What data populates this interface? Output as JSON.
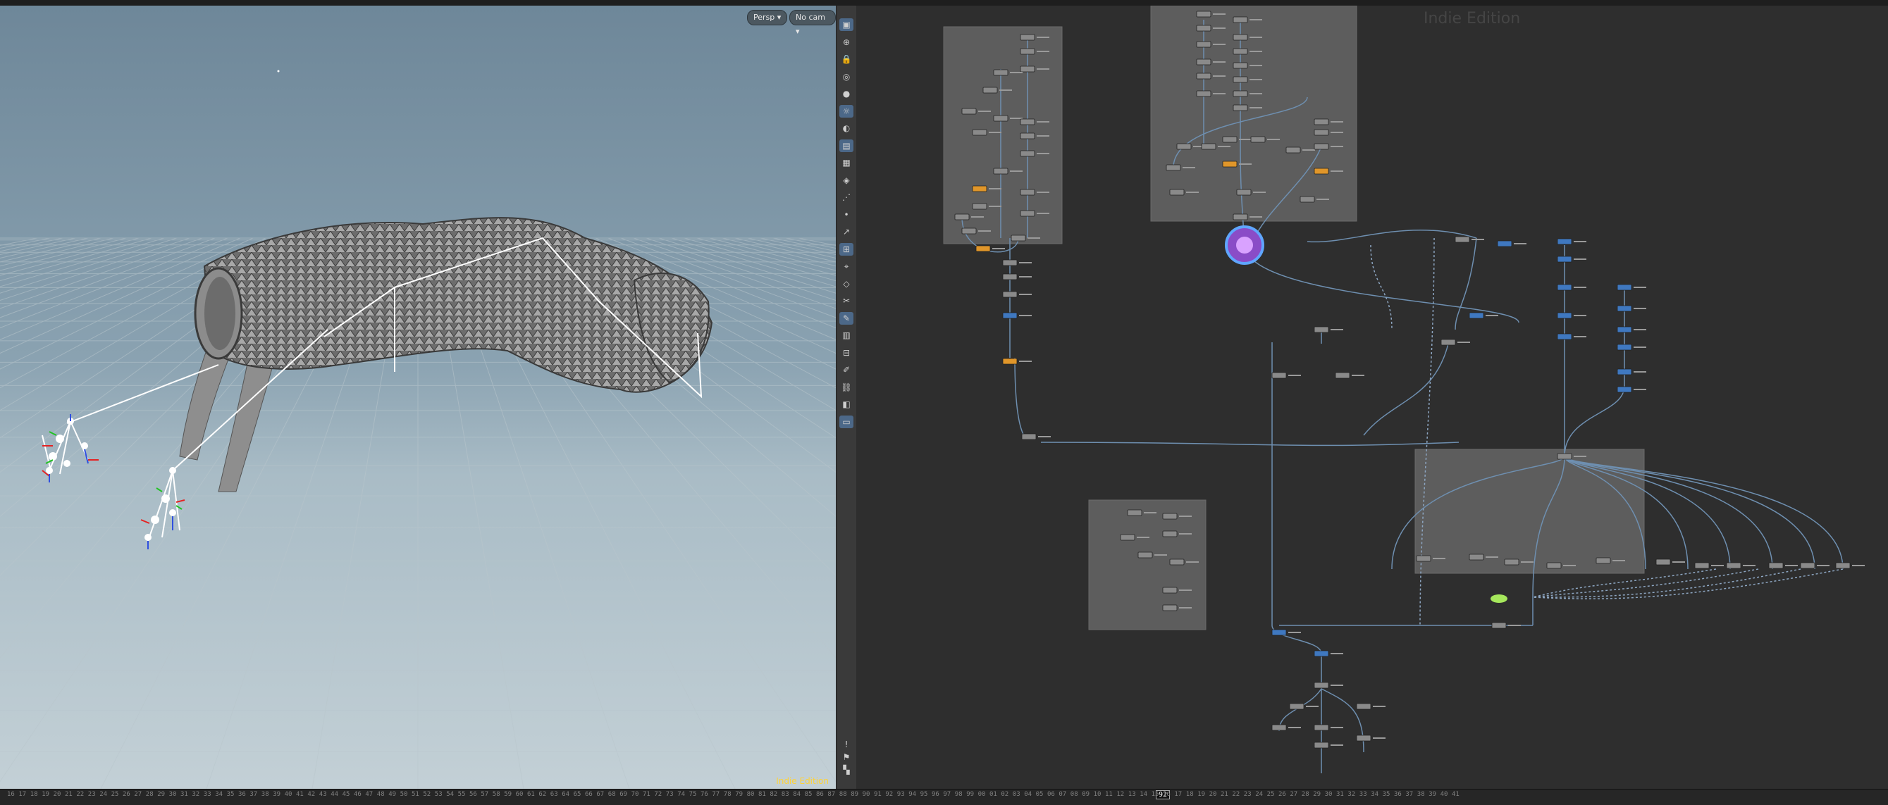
{
  "viewport": {
    "camera_menu": "Persp",
    "cam_menu": "No cam",
    "watermark": "Indie Edition"
  },
  "network": {
    "watermark": "Indie Edition"
  },
  "shelf": {
    "icons": [
      "select-icon",
      "move-icon",
      "lock-icon",
      "snap-icon",
      "render-icon",
      "light-icon",
      "visibility-icon",
      "camera-icon",
      "display-icon",
      "wire-icon",
      "shade-icon",
      "point-icon",
      "normal-icon",
      "grid-icon",
      "handle-icon",
      "ghost-icon",
      "cut-icon",
      "brush-icon",
      "texture-icon",
      "group-icon",
      "paint-icon",
      "chain-icon",
      "display-toggle-icon",
      "frame-icon",
      "info-icon",
      "flag-icon",
      "layout-icon"
    ]
  },
  "timeline": {
    "current_frame": "92",
    "labels": [
      "16",
      "17",
      "18",
      "19",
      "20",
      "21",
      "22",
      "23",
      "24",
      "25",
      "26",
      "27",
      "28",
      "29",
      "30",
      "31",
      "32",
      "33",
      "34",
      "35",
      "36",
      "37",
      "38",
      "39",
      "40",
      "41",
      "42",
      "43",
      "44",
      "45",
      "46",
      "47",
      "48",
      "49",
      "50",
      "51",
      "52",
      "53",
      "54",
      "55",
      "56",
      "57",
      "58",
      "59",
      "60",
      "61",
      "62",
      "63",
      "64",
      "65",
      "66",
      "67",
      "68",
      "69",
      "70",
      "71",
      "72",
      "73",
      "74",
      "75",
      "76",
      "77",
      "78",
      "79",
      "80",
      "81",
      "82",
      "83",
      "84",
      "85",
      "86",
      "87",
      "88",
      "89",
      "90",
      "91",
      "92",
      "93",
      "94",
      "95",
      "96",
      "97",
      "98",
      "99",
      "00",
      "01",
      "02",
      "03",
      "04",
      "05",
      "06",
      "07",
      "08",
      "09",
      "10",
      "11",
      "12",
      "13",
      "14",
      "15",
      "16",
      "17",
      "18",
      "19",
      "20",
      "21",
      "22",
      "23",
      "24",
      "25",
      "26",
      "27",
      "28",
      "29",
      "30",
      "31",
      "32",
      "33",
      "34",
      "35",
      "36",
      "37",
      "38",
      "39",
      "40",
      "41"
    ]
  },
  "colors": {
    "node_gray": "#8a8a8a",
    "node_orange": "#e0962a",
    "node_blue": "#3f78c0",
    "wire": "#6e8fb0",
    "network_box": "#5f5f5f"
  }
}
